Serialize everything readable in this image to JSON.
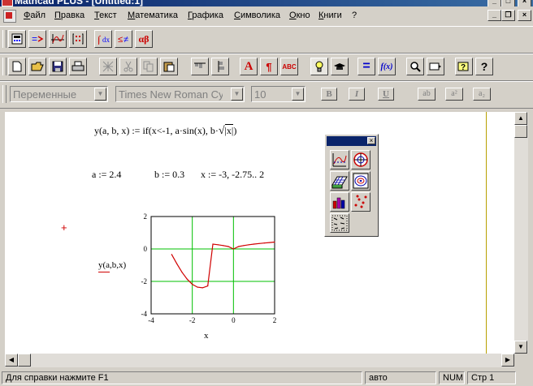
{
  "window": {
    "title": "Mathcad PLUS - [Untitled:1]",
    "controls": {
      "minimize": "_",
      "maximize": "□",
      "close": "×"
    }
  },
  "menu": {
    "items": [
      "Файл",
      "Правка",
      "Текст",
      "Математика",
      "Графика",
      "Символика",
      "Окно",
      "Книги",
      "?"
    ]
  },
  "math_toolbar": {
    "buttons": [
      "calculator-palette",
      "evaluation-palette",
      "graph-palette",
      "matrix-palette",
      "calculus-palette",
      "boolean-palette",
      "greek-palette"
    ],
    "greek_label": "αβ"
  },
  "standard_toolbar": {
    "buttons": [
      "new",
      "open",
      "save",
      "print",
      "check-spelling-disabled",
      "cut",
      "copy",
      "paste",
      "align-across",
      "align-down",
      "text-region",
      "paragraph",
      "spell-check",
      "calculate-on",
      "resource-center",
      "equals",
      "insert-function",
      "zoom",
      "copy-region",
      "help-context",
      "help"
    ],
    "text_icon_label": "A",
    "paragraph_label": "¶",
    "spell_label": "ABC",
    "equals_label": "=",
    "function_label": "f(x)",
    "help_label": "?"
  },
  "format_toolbar": {
    "style": "Переменные",
    "font": "Times New Roman Cyr",
    "size": "10",
    "bold": "B",
    "italic": "I",
    "underline": "U",
    "subscript_label": "ab",
    "superscript_label": "a²",
    "lower_label": "a₂"
  },
  "worksheet": {
    "definition": "y(a, b, x)  := if(x<-1, a·sin(x), b·√|x|)",
    "def_lhs": "y(a, b, x)",
    "def_op": ":=",
    "def_rhs_head": "if(x<-1, a·sin(x), b·",
    "def_rhs_abs": "|x|",
    "def_rhs_tail": ")",
    "a_def": "a := 2.4",
    "b_def": "b := 0.3",
    "x_def": "x := -3, -2.75.. 2",
    "crosshair": "+",
    "graph_ylabel": "y(a,b,x)",
    "graph_xlabel": "x"
  },
  "chart_data": {
    "type": "line",
    "title": "",
    "xlabel": "x",
    "ylabel": "y(a,b,x)",
    "xlim": [
      -4,
      2
    ],
    "ylim": [
      -4,
      2
    ],
    "x_ticks": [
      "-4",
      "-2",
      "0",
      "2"
    ],
    "y_ticks": [
      "2",
      "0",
      "-2",
      "-4"
    ],
    "grid": true,
    "grid_color": "#00c000",
    "line_color": "#d00000",
    "series": [
      {
        "x": [
          -3,
          -2.75,
          -2.5,
          -2.25,
          -2,
          -1.75,
          -1.5,
          -1.25,
          -1,
          -0.75,
          -0.5,
          -0.25,
          0,
          0.25,
          0.5,
          0.75,
          1,
          1.25,
          1.5,
          1.75,
          2
        ],
        "y": [
          -0.339,
          -0.914,
          -1.436,
          -1.862,
          -2.182,
          -2.354,
          -2.394,
          -2.279,
          0.3,
          0.26,
          0.212,
          0.15,
          0,
          0.15,
          0.212,
          0.26,
          0.3,
          0.335,
          0.367,
          0.397,
          0.424
        ]
      }
    ]
  },
  "statusbar": {
    "hint": "Для справки нажмите F1",
    "mode": "авто",
    "num": "NUM",
    "page": "Стр 1"
  },
  "graph_palette": {
    "buttons": [
      "xy-plot",
      "polar-plot",
      "surface-plot",
      "contour-plot",
      "3d-bar-plot",
      "3d-scatter-plot",
      "vector-field-plot"
    ]
  },
  "colors": {
    "titlebar": "#0a246a",
    "chrome": "#d4d0c8",
    "plot_line": "#d00000",
    "grid": "#00c000",
    "crosshair": "#d00000"
  }
}
